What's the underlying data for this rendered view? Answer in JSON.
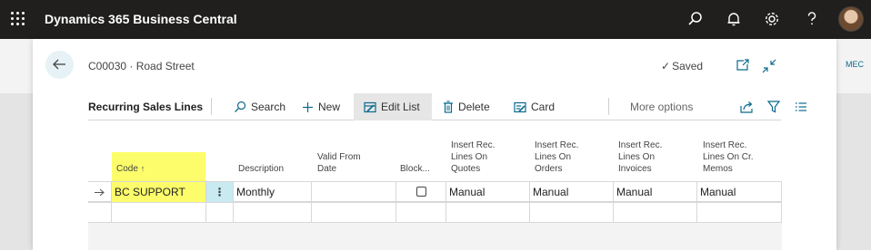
{
  "app": {
    "title": "Dynamics 365 Business Central"
  },
  "topbar_icons": [
    "waffle-icon",
    "search-icon",
    "bell-icon",
    "gear-icon",
    "help-icon",
    "avatar"
  ],
  "background": {
    "right_label": "MEC"
  },
  "dialog": {
    "record_title": "C00030 · Road Street",
    "saved_label": "Saved"
  },
  "actionbar": {
    "caption": "Recurring Sales Lines",
    "actions": {
      "search": "Search",
      "new": "New",
      "edit_list": "Edit List",
      "delete": "Delete",
      "card": "Card",
      "more": "More options"
    }
  },
  "grid": {
    "headers": {
      "code": "Code",
      "description": "Description",
      "valid_from_1": "Valid From",
      "valid_from_2": "Date",
      "blocked": "Block...",
      "quotes_1": "Insert Rec.",
      "quotes_2": "Lines On",
      "quotes_3": "Quotes",
      "orders_1": "Insert Rec.",
      "orders_2": "Lines On",
      "orders_3": "Orders",
      "invoices_1": "Insert Rec.",
      "invoices_2": "Lines On",
      "invoices_3": "Invoices",
      "crmemos_1": "Insert Rec.",
      "crmemos_2": "Lines On Cr.",
      "crmemos_3": "Memos"
    },
    "rows": [
      {
        "code": "BC SUPPORT",
        "description": "Monthly",
        "valid_from": "",
        "blocked": false,
        "quotes": "Manual",
        "orders": "Manual",
        "invoices": "Manual",
        "crmemos": "Manual"
      }
    ]
  },
  "colors": {
    "appbar": "#201f1e",
    "highlight_yellow": "#fdfd6b",
    "selected_cell": "#c8eaf0",
    "accent": "#0b6a8d"
  }
}
